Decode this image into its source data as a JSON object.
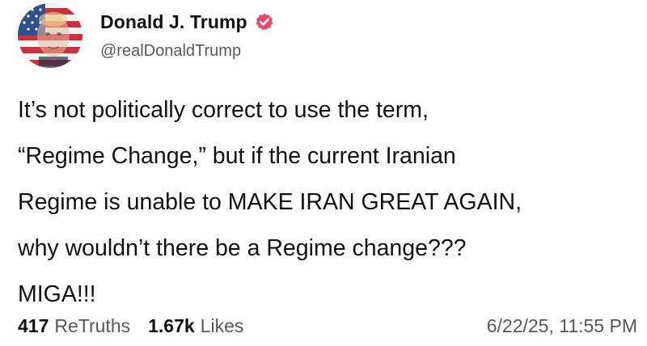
{
  "author": {
    "display_name": "Donald J. Trump",
    "handle": "@realDonaldTrump",
    "avatar_icon": "flag-portrait-avatar",
    "verified_icon": "verified-badge-icon",
    "verified_color": "#e84a6a"
  },
  "post": {
    "lines": [
      "It’s not politically correct to use the term,",
      "“Regime Change,” but if the current Iranian",
      "Regime is unable to MAKE IRAN GREAT AGAIN,",
      "why wouldn’t there be a Regime change???",
      "MIGA!!!"
    ]
  },
  "stats": {
    "retruths_count": "417",
    "retruths_label": "ReTruths",
    "likes_count": "1.67k",
    "likes_label": "Likes",
    "timestamp": "6/22/25, 11:55 PM"
  }
}
